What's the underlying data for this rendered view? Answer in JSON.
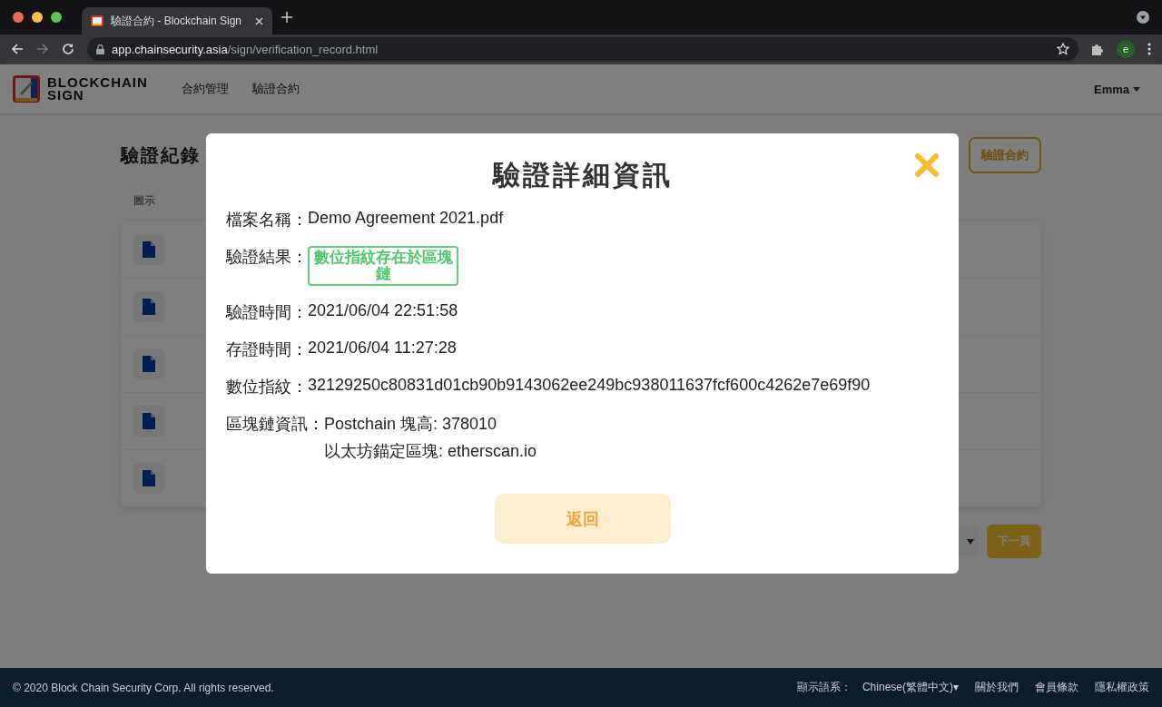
{
  "browser": {
    "tab_title": "驗證合約 - Blockchain Sign",
    "url_host": "app.chainsecurity.asia",
    "url_path": "/sign/verification_record.html",
    "avatar": "e"
  },
  "header": {
    "logo": "BLOCKCHAIN SIGN",
    "nav": [
      "合約管理",
      "驗證合約"
    ],
    "user": "Emma"
  },
  "page": {
    "title": "驗證紀錄",
    "verify_button": "驗證合約",
    "column": "圖示",
    "rows": [
      {
        "kind": "file"
      },
      {
        "kind": "file"
      },
      {
        "kind": "file"
      },
      {
        "kind": "file"
      },
      {
        "kind": "file"
      }
    ],
    "next_button": "下一頁"
  },
  "modal": {
    "title": "驗證詳細資訊",
    "fields": [
      {
        "kind": "text",
        "label": "檔案名稱：",
        "value": "Demo Agreement 2021.pdf"
      },
      {
        "kind": "badge",
        "label": "驗證結果：",
        "value": "數位指紋存在於區塊鏈"
      },
      {
        "kind": "text",
        "label": "驗證時間：",
        "value": "2021/06/04 22:51:58"
      },
      {
        "kind": "text",
        "label": "存證時間：",
        "value": "2021/06/04 11:27:28"
      },
      {
        "kind": "text",
        "label": "數位指紋：",
        "value": "32129250c80831d01cb90b9143062ee249bc938011637fcf600c4262e7e69f90"
      },
      {
        "kind": "lines",
        "label": "區塊鏈資訊：",
        "values": [
          "Postchain 塊高: 378010",
          "以太坊錨定區塊: etherscan.io"
        ]
      }
    ],
    "back_button": "返回"
  },
  "footer": {
    "copyright": "© 2020 Block Chain Security Corp. All rights reserved.",
    "language_label": "顯示語系：",
    "language": "Chinese(繁體中文)▾",
    "links": [
      "關於我們",
      "會員條款",
      "隱私權政策"
    ]
  }
}
